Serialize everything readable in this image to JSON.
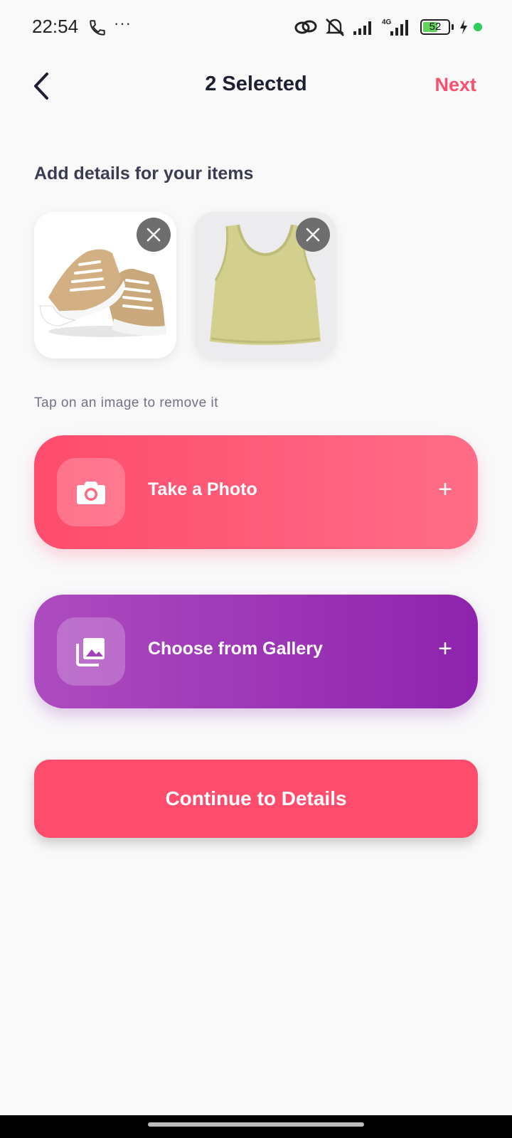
{
  "status_bar": {
    "time": "22:54",
    "dots": "···",
    "network_label": "4G",
    "battery_level": "52",
    "icons": [
      "call-icon",
      "link-icon",
      "mute-icon",
      "signal-icon",
      "signal-4g-icon",
      "battery-icon",
      "charging-icon",
      "active-dot-icon"
    ]
  },
  "header": {
    "title": "2 Selected",
    "next_label": "Next",
    "back_icon": "chevron-left-icon"
  },
  "section_title": "Add details for your items",
  "selected_items": [
    {
      "image": "sneakers-image",
      "remove_icon": "close-icon"
    },
    {
      "image": "tank-top-image",
      "remove_icon": "close-icon"
    }
  ],
  "hint": "Tap on an image to remove it",
  "actions": {
    "photo": {
      "label": "Take a Photo",
      "icon": "camera-icon",
      "plus": "+"
    },
    "gallery": {
      "label": "Choose from Gallery",
      "icon": "gallery-icon",
      "plus": "+"
    }
  },
  "continue_label": "Continue to Details",
  "colors": {
    "accent": "#fe4c6c",
    "gallery_start": "#ad4cc0",
    "gallery_end": "#8e23ad",
    "title": "#1e1f33"
  }
}
